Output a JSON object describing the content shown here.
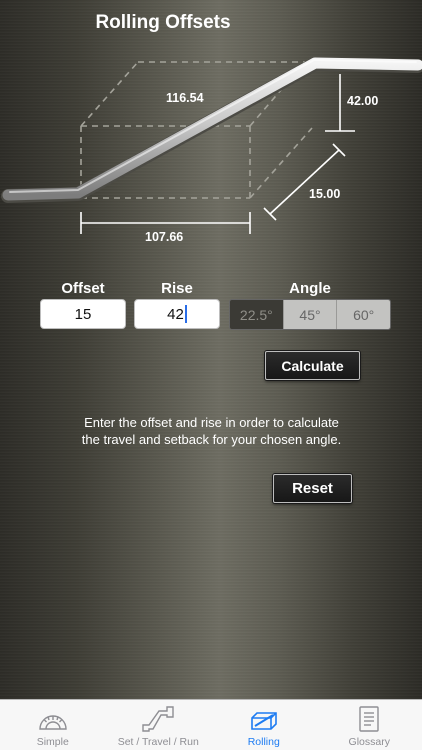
{
  "header": {
    "title": "Rolling Offsets"
  },
  "diagram": {
    "labels": {
      "travel": "116.54",
      "rise": "42.00",
      "setback": "15.00",
      "run": "107.66"
    }
  },
  "form": {
    "offset_label": "Offset",
    "rise_label": "Rise",
    "angle_label": "Angle",
    "offset_value": "15",
    "rise_value": "42",
    "angles": [
      "22.5°",
      "45°",
      "60°"
    ],
    "selected_angle": "22.5°"
  },
  "buttons": {
    "calculate": "Calculate",
    "reset": "Reset"
  },
  "instructions": {
    "line1": "Enter the offset and rise in order to calculate",
    "line2": "the travel and setback for your chosen angle."
  },
  "tabbar": {
    "tabs": [
      {
        "label": "Simple",
        "icon": "protractor-icon",
        "active": false
      },
      {
        "label": "Set / Travel / Run",
        "icon": "pipe-offset-icon",
        "active": false
      },
      {
        "label": "Rolling",
        "icon": "box-pipe-icon",
        "active": true
      },
      {
        "label": "Glossary",
        "icon": "document-icon",
        "active": false
      }
    ]
  },
  "colors": {
    "accent": "#1e7cf2",
    "tab_inactive": "#8e8e93",
    "segment_selected": "#3b3a35",
    "segment_bg": "#c3c3c1"
  }
}
